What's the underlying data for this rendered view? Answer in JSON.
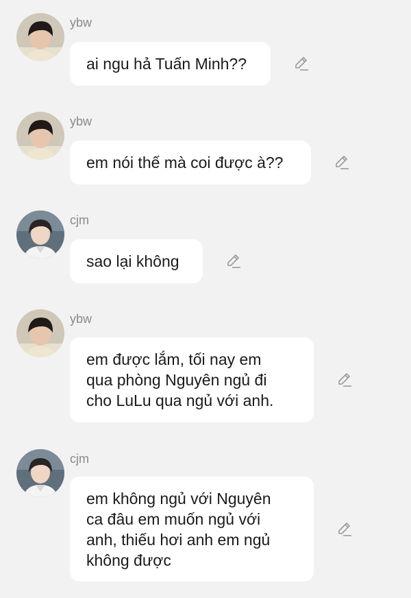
{
  "messages": [
    {
      "user": "ybw",
      "text": "ai ngu hả Tuấn Minh??",
      "avatar_icon": "user-avatar-icon",
      "edit_icon": "pencil-icon"
    },
    {
      "user": "ybw",
      "text": "em nói thế mà coi được à??",
      "avatar_icon": "user-avatar-icon",
      "edit_icon": "pencil-icon"
    },
    {
      "user": "cjm",
      "text": "sao lại không",
      "avatar_icon": "user-avatar-icon",
      "edit_icon": "pencil-icon"
    },
    {
      "user": "ybw",
      "text": "em được lắm, tối nay em\nqua phòng Nguyên ngủ đi\ncho LuLu qua ngủ với anh.",
      "avatar_icon": "user-avatar-icon",
      "edit_icon": "pencil-icon"
    },
    {
      "user": "cjm",
      "text": "em không ngủ với Nguyên\nca đâu em muốn ngủ với\nanh, thiếu hơi anh em ngủ\nkhông được",
      "avatar_icon": "user-avatar-icon",
      "edit_icon": "pencil-icon"
    }
  ],
  "colors": {
    "background": "#f2f2f2",
    "bubble": "#ffffff",
    "username": "#8a8a8a",
    "text": "#1a1a1a",
    "icon": "#9a9a9a"
  }
}
